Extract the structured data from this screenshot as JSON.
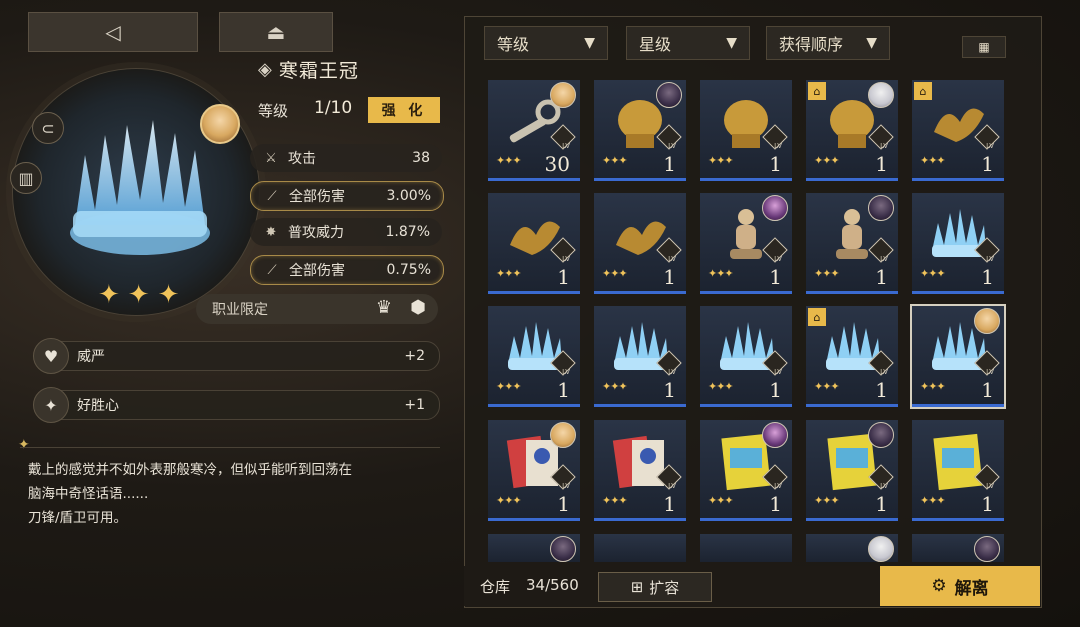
{
  "top_buttons": {
    "back_icon": "◁",
    "collapse_icon": "⏏"
  },
  "item": {
    "name": "寒霜王冠",
    "level_label": "等级",
    "level_value": "1/10",
    "enhance_label": "强 化",
    "stars": [
      "✦",
      "✦",
      "✦"
    ],
    "stats": [
      {
        "icon": "sword-icon",
        "label": "攻击",
        "value": "38",
        "highlight": false
      },
      {
        "icon": "damage-icon",
        "label": "全部伤害",
        "value": "3.00%",
        "highlight": true
      },
      {
        "icon": "power-icon",
        "label": "普攻威力",
        "value": "1.87%",
        "highlight": false
      },
      {
        "icon": "damage-icon",
        "label": "全部伤害",
        "value": "0.75%",
        "highlight": true
      }
    ],
    "class_restriction_label": "职业限定",
    "traits": [
      {
        "icon": "shield-heart-icon",
        "label": "威严",
        "value": "+2"
      },
      {
        "icon": "sparkle-arrow-icon",
        "label": "好胜心",
        "value": "+1"
      }
    ],
    "description": [
      "戴上的感觉并不如外表那般寒冷，但似乎能听到回荡在",
      "脑海中奇怪话语......",
      "刀锋/盾卫可用。"
    ]
  },
  "filters": [
    {
      "label": "等级"
    },
    {
      "label": "星级"
    },
    {
      "label": "获得顺序"
    }
  ],
  "grid": [
    {
      "art": "key",
      "level": "30",
      "stars": "✦✦✦",
      "lock": false,
      "avatar": "blonde"
    },
    {
      "art": "lion",
      "level": "1",
      "stars": "✦✦✦",
      "lock": false,
      "avatar": "dark"
    },
    {
      "art": "lion",
      "level": "1",
      "stars": "✦✦✦",
      "lock": false,
      "avatar": ""
    },
    {
      "art": "lion",
      "level": "1",
      "stars": "✦✦✦",
      "lock": true,
      "avatar": "white"
    },
    {
      "art": "wings",
      "level": "1",
      "stars": "✦✦✦",
      "lock": true,
      "avatar": ""
    },
    {
      "art": "wings",
      "level": "1",
      "stars": "✦✦✦",
      "lock": false,
      "avatar": ""
    },
    {
      "art": "wings",
      "level": "1",
      "stars": "✦✦✦",
      "lock": false,
      "avatar": ""
    },
    {
      "art": "mannequin",
      "level": "1",
      "stars": "✦✦✦",
      "lock": false,
      "avatar": "purple"
    },
    {
      "art": "mannequin",
      "level": "1",
      "stars": "✦✦✦",
      "lock": false,
      "avatar": "dark"
    },
    {
      "art": "crown",
      "level": "1",
      "stars": "✦✦✦",
      "lock": false,
      "avatar": ""
    },
    {
      "art": "crown",
      "level": "1",
      "stars": "✦✦✦",
      "lock": false,
      "avatar": ""
    },
    {
      "art": "crown",
      "level": "1",
      "stars": "✦✦✦",
      "lock": false,
      "avatar": ""
    },
    {
      "art": "crown",
      "level": "1",
      "stars": "✦✦✦",
      "lock": false,
      "avatar": ""
    },
    {
      "art": "crown",
      "level": "1",
      "stars": "✦✦✦",
      "lock": true,
      "avatar": ""
    },
    {
      "art": "crown",
      "level": "1",
      "stars": "✦✦✦",
      "lock": false,
      "avatar": "blonde",
      "selected": true
    },
    {
      "art": "card-red",
      "level": "1",
      "stars": "✦✦✦",
      "lock": false,
      "avatar": "blonde"
    },
    {
      "art": "card-red",
      "level": "1",
      "stars": "✦✦✦",
      "lock": false,
      "avatar": ""
    },
    {
      "art": "card-holiday",
      "level": "1",
      "stars": "✦✦✦",
      "lock": false,
      "avatar": "purple"
    },
    {
      "art": "card-holiday",
      "level": "1",
      "stars": "✦✦✦",
      "lock": false,
      "avatar": "dark"
    },
    {
      "art": "card-holiday",
      "level": "1",
      "stars": "✦✦✦",
      "lock": false,
      "avatar": ""
    }
  ],
  "warehouse": {
    "label": "仓库",
    "value": "34/560"
  },
  "expand_label": "扩容",
  "dismantle_label": "解离",
  "colors": {
    "accent": "#e8b94a",
    "star": "#f0c35a",
    "rarity_bar": "#3a6ad0"
  }
}
